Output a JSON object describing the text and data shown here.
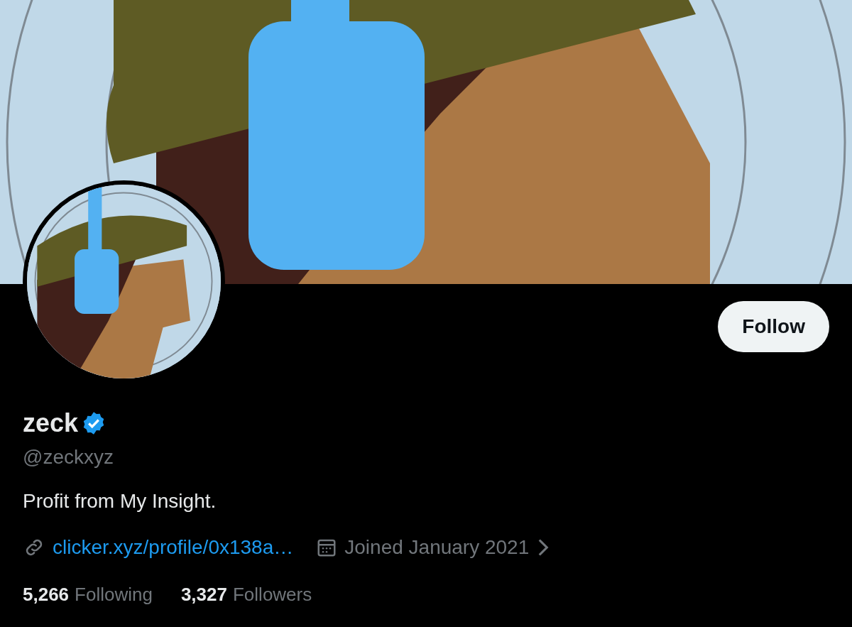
{
  "profile": {
    "name": "zeck",
    "verified": true,
    "handle": "@zeckxyz",
    "bio": "Profit from My Insight.",
    "website": "clicker.xyz/profile/0x138a…",
    "joined": "Joined January 2021",
    "stats": [
      {
        "count": "5,266",
        "label": "Following"
      },
      {
        "count": "3,327",
        "label": "Followers"
      }
    ]
  },
  "follow_button": {
    "label": "Follow"
  }
}
